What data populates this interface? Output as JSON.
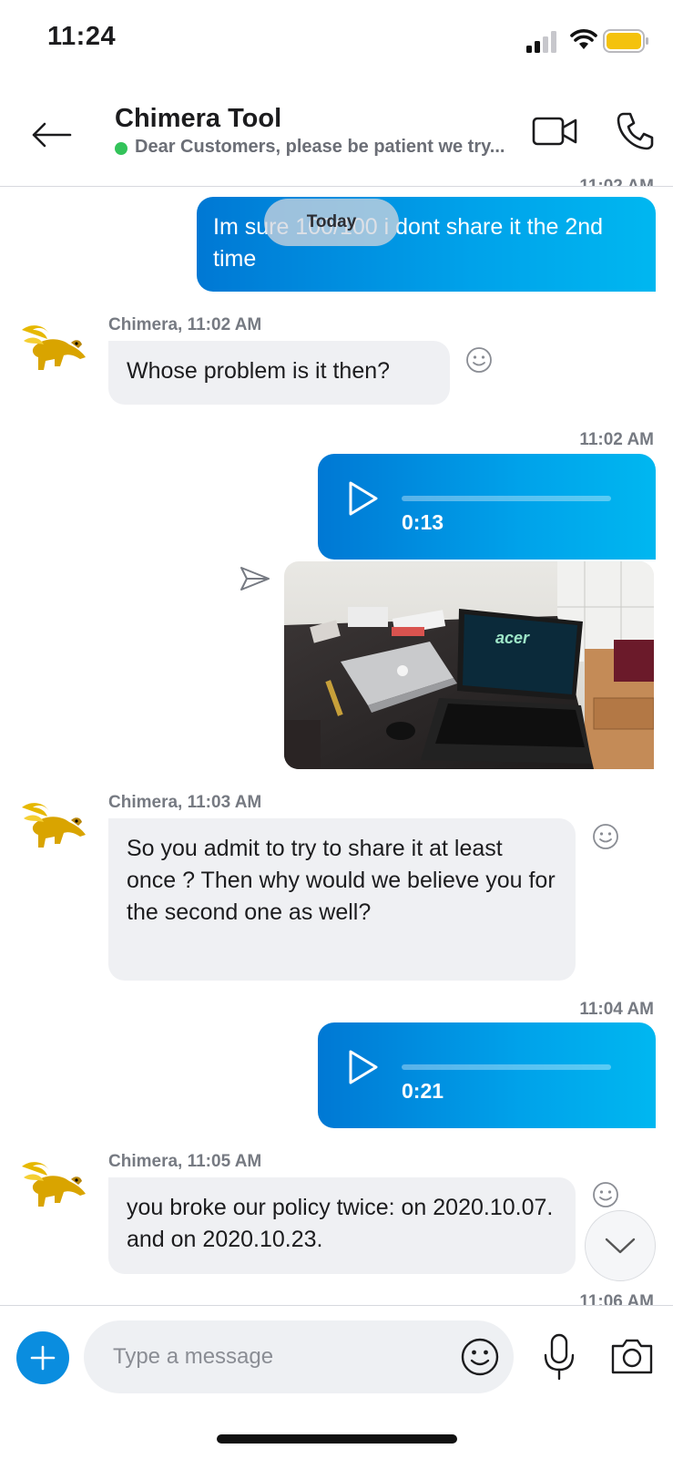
{
  "status_bar": {
    "time": "11:24"
  },
  "header": {
    "contact_name": "Chimera Tool",
    "mood": "Dear Customers, please be patient we try..."
  },
  "chat": {
    "today_label": "Today",
    "top_timestamp_partial": "11:02 AM",
    "messages": [
      {
        "type": "outgoing_text",
        "text": "Im sure 100/100 i dont share it the 2nd time"
      },
      {
        "type": "incoming_text",
        "sender_meta": "Chimera, 11:02 AM",
        "text": "Whose problem is it then?"
      },
      {
        "type": "outgoing_voice",
        "timestamp": "11:02 AM",
        "duration": "0:13"
      },
      {
        "type": "outgoing_photo",
        "laptop_brand": "acer"
      },
      {
        "type": "incoming_text",
        "sender_meta": "Chimera, 11:03 AM",
        "text": "So you admit to try to share it at least once ? Then why would we believe you for the second one as well?"
      },
      {
        "type": "outgoing_voice",
        "timestamp": "11:04 AM",
        "duration": "0:21"
      },
      {
        "type": "incoming_text",
        "sender_meta": "Chimera, 11:05 AM",
        "text": "you broke our policy twice: on 2020.10.07. and on 2020.10.23."
      }
    ],
    "bottom_timestamp_partial": "11:06 AM"
  },
  "composer": {
    "placeholder": "Type a message"
  },
  "icons": [
    "back-arrow-icon",
    "video-call-icon",
    "phone-icon",
    "play-icon",
    "send-status-icon",
    "emoji-react-icon",
    "chevron-down-icon",
    "plus-icon",
    "emoji-icon",
    "mic-icon",
    "camera-icon"
  ],
  "colors": {
    "accent": "#0078d4",
    "bubble_out_end": "#00b7f0",
    "bubble_in": "#eff0f3",
    "presence": "#33c35a"
  }
}
